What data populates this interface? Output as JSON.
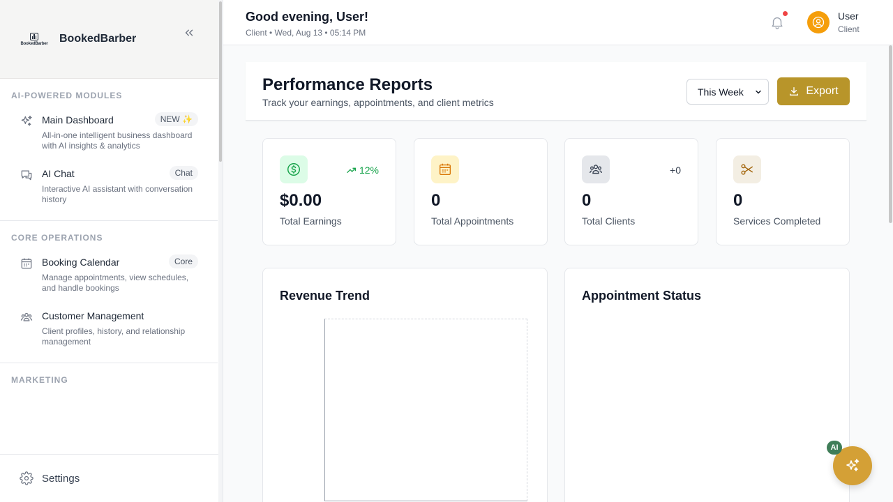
{
  "sidebar": {
    "brand": "BookedBarber",
    "logo_text": "BookedBarber",
    "sections": [
      {
        "title": "AI-POWERED MODULES",
        "items": [
          {
            "title": "Main Dashboard",
            "badge": "NEW ✨",
            "desc": "All-in-one intelligent business dashboard with AI insights & analytics",
            "icon": "sparkles-icon"
          },
          {
            "title": "AI Chat",
            "badge": "Chat",
            "desc": "Interactive AI assistant with conversation history",
            "icon": "chat-icon"
          }
        ]
      },
      {
        "title": "CORE OPERATIONS",
        "items": [
          {
            "title": "Booking Calendar",
            "badge": "Core",
            "desc": "Manage appointments, view schedules, and handle bookings",
            "icon": "calendar-icon"
          },
          {
            "title": "Customer Management",
            "badge": "",
            "desc": "Client profiles, history, and relationship management",
            "icon": "users-icon"
          }
        ]
      },
      {
        "title": "MARKETING",
        "items": []
      }
    ],
    "settings_label": "Settings"
  },
  "header": {
    "greeting": "Good evening, User!",
    "subtitle": "Client • Wed, Aug 13 • 05:14 PM",
    "user_name": "User",
    "user_role": "Client"
  },
  "report": {
    "title": "Performance Reports",
    "subtitle": "Track your earnings, appointments, and client metrics",
    "period": "This Week",
    "export_label": "Export"
  },
  "stats": [
    {
      "value": "$0.00",
      "label": "Total Earnings",
      "trend": "12%",
      "icon": "dollar-icon",
      "icon_bg": "#dcfce7",
      "icon_color": "#16a34a"
    },
    {
      "value": "0",
      "label": "Total Appointments",
      "trend": "",
      "icon": "calendar-icon",
      "icon_bg": "#fef3c7",
      "icon_color": "#d97706"
    },
    {
      "value": "0",
      "label": "Total Clients",
      "trend": "+0",
      "icon": "users-icon",
      "icon_bg": "#e5e7eb",
      "icon_color": "#374151"
    },
    {
      "value": "0",
      "label": "Services Completed",
      "trend": "",
      "icon": "scissors-icon",
      "icon_bg": "#f3eee3",
      "icon_color": "#a16207"
    }
  ],
  "charts": {
    "revenue_title": "Revenue Trend",
    "status_title": "Appointment Status"
  },
  "fab": {
    "badge": "AI",
    "icon": "sparkles-icon"
  },
  "colors": {
    "accent": "#b8952a",
    "fab": "#d4a036",
    "trend_up": "#16a34a",
    "notification": "#ef4444"
  }
}
